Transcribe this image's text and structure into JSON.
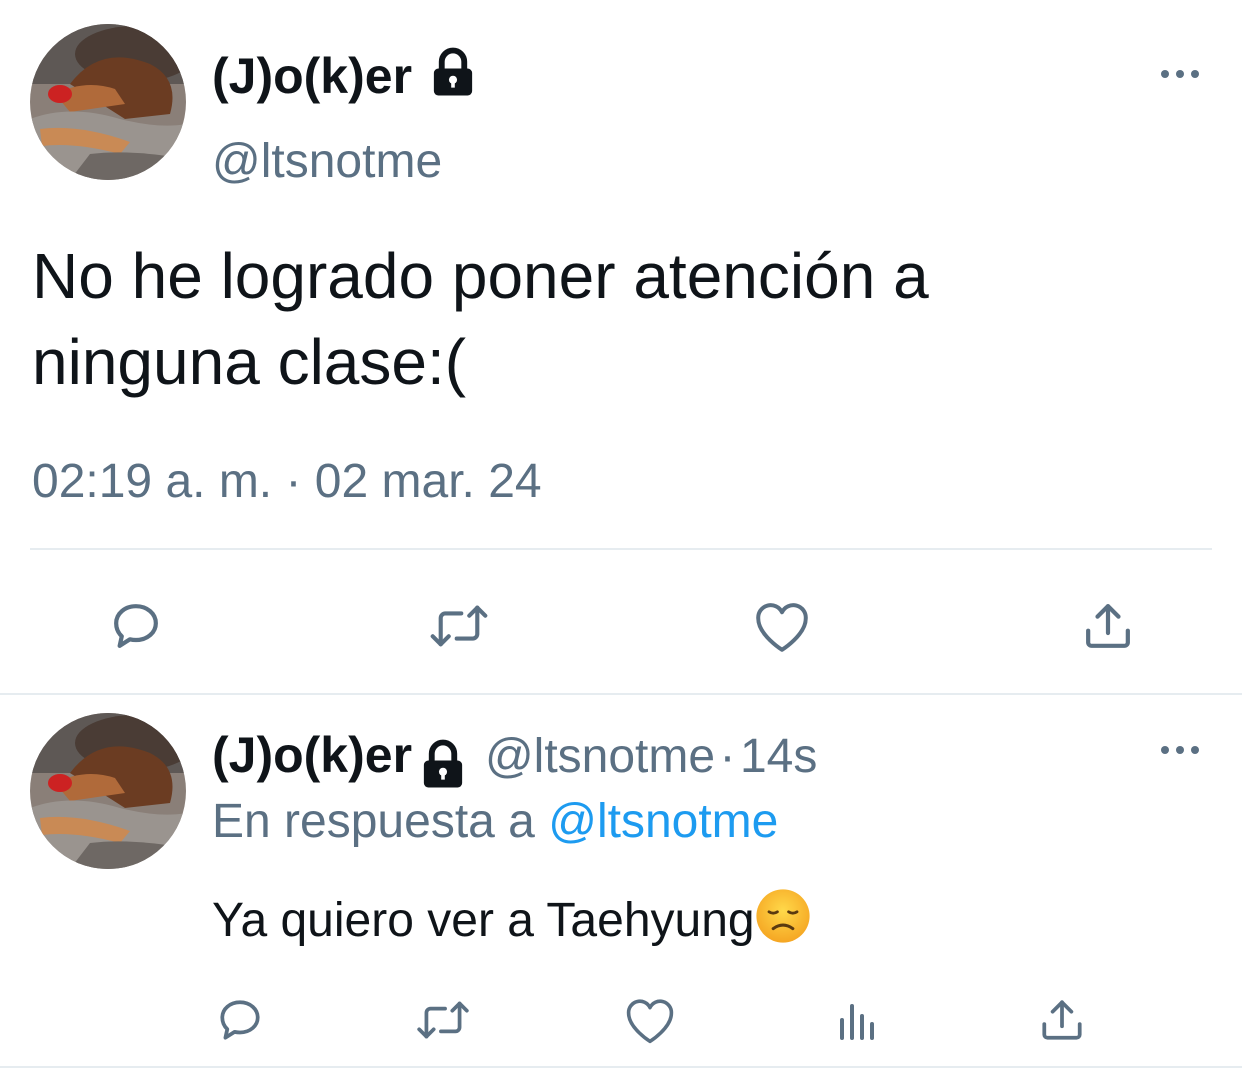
{
  "main_tweet": {
    "display_name": "(J)o(k)er",
    "handle": "@ltsnotme",
    "text_line1": "No he logrado poner atención a",
    "text_line2": "ninguna clase:(",
    "timestamp": "02:19 a. m. · 02 mar. 24",
    "icons": [
      "lock-icon",
      "more-icon",
      "reply-icon",
      "retweet-icon",
      "like-icon",
      "share-icon"
    ]
  },
  "reply_tweet": {
    "display_name": "(J)o(k)er",
    "handle": "@ltsnotme",
    "separator": "·",
    "time": "14s",
    "replying_prefix": "En respuesta a",
    "replying_to": "@ltsnotme",
    "text": "Ya quiero ver a Taehyung",
    "emoji": "disappointed-face-emoji",
    "icons": [
      "lock-icon",
      "more-icon",
      "reply-icon",
      "retweet-icon",
      "like-icon",
      "analytics-icon",
      "share-icon"
    ]
  },
  "colors": {
    "text_primary": "#0f1419",
    "text_secondary": "#5b7083",
    "accent": "#1d9bf0",
    "divider": "#e6ecf0"
  }
}
